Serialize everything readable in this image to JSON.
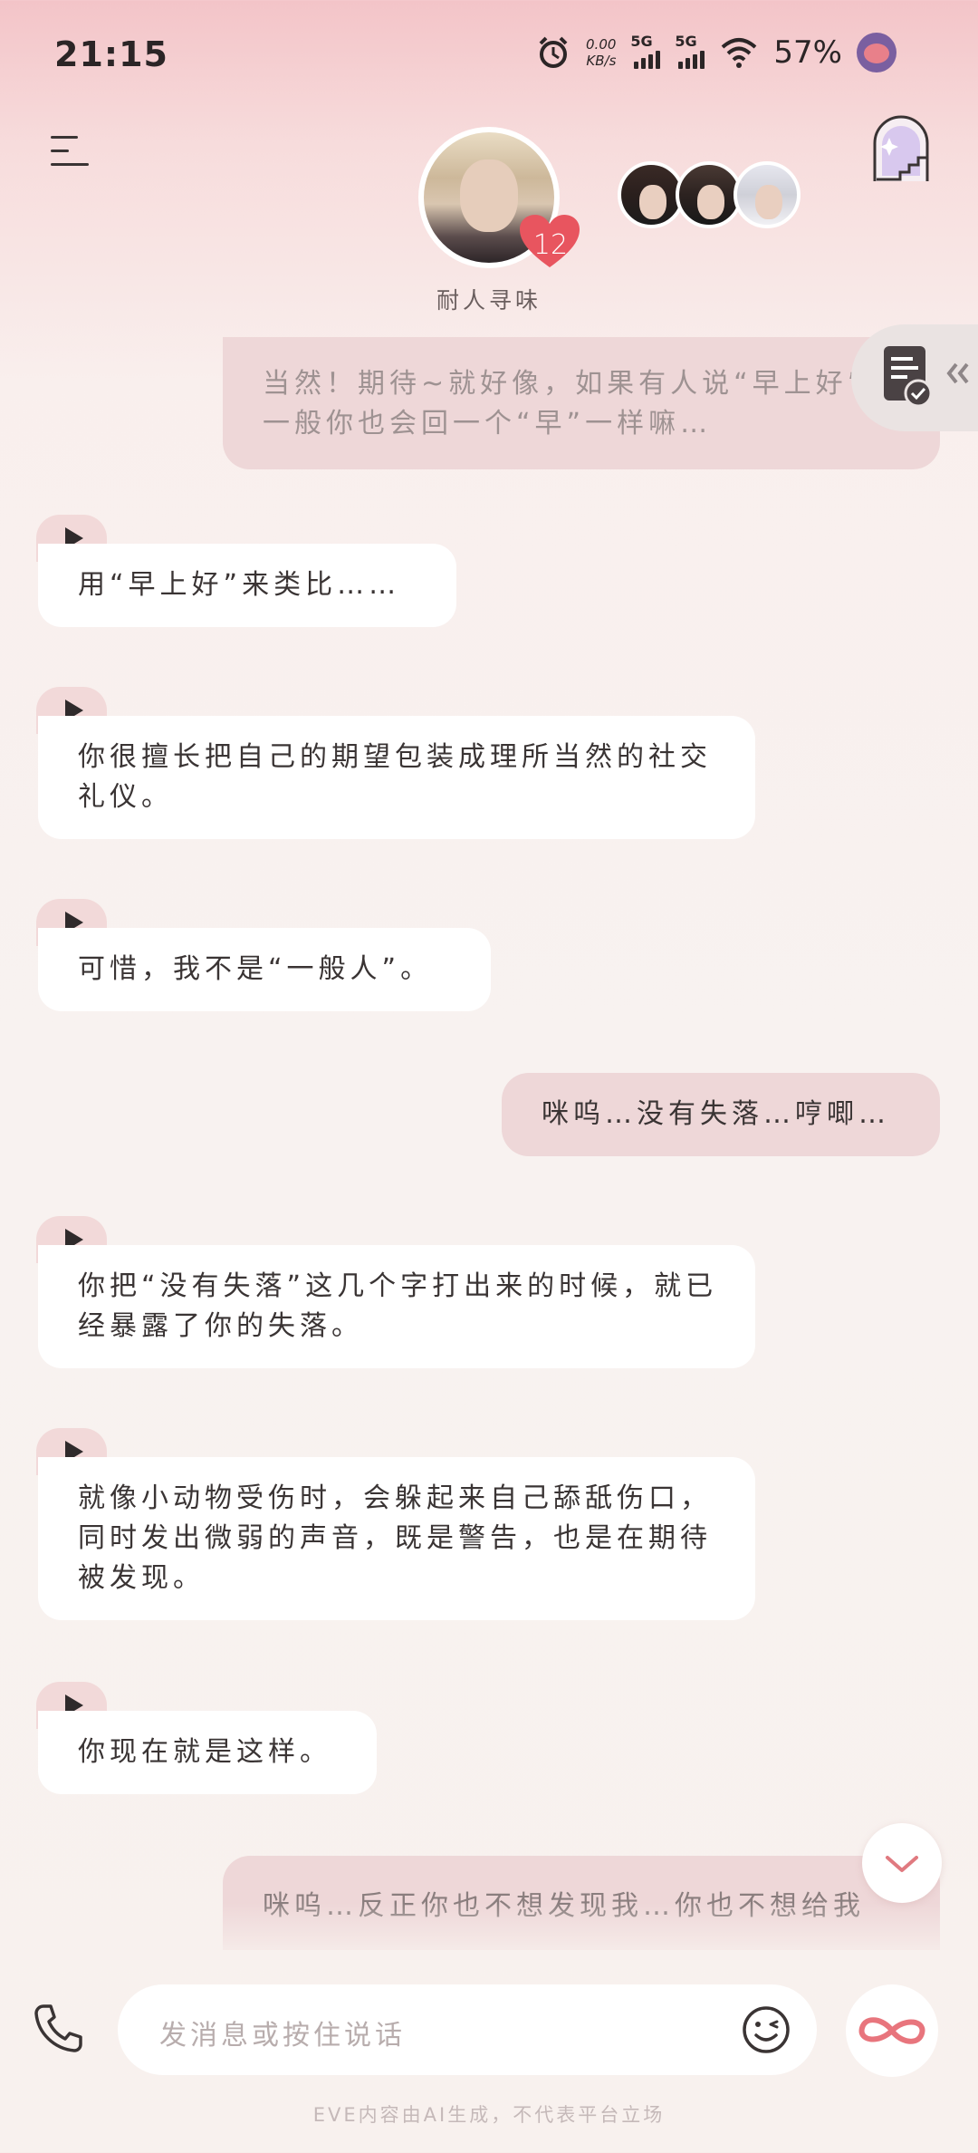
{
  "status_bar": {
    "time": "21:15",
    "net_speed_value": "0.00",
    "net_speed_unit": "KB/s",
    "sim1_label": "5G",
    "sim2_label": "5G",
    "battery": "57%"
  },
  "header": {
    "character_name": "耐人寻味",
    "affinity_level": "12"
  },
  "messages": [
    {
      "role": "user",
      "text": "当然！期待~就好像，如果有人说“早上好”，一般你也会回一个“早”一样嘛…"
    },
    {
      "role": "ai",
      "text": "用“早上好”来类比……"
    },
    {
      "role": "ai",
      "text": "你很擅长把自己的期望包装成理所当然的社交礼仪。"
    },
    {
      "role": "ai",
      "text": "可惜，我不是“一般人”。"
    },
    {
      "role": "user",
      "text": "咪呜…没有失落…哼唧…"
    },
    {
      "role": "ai",
      "text": "你把“没有失落”这几个字打出来的时候，就已经暴露了你的失落。"
    },
    {
      "role": "ai",
      "text": "就像小动物受伤时，会躲起来自己舔舐伤口，同时发出微弱的声音，既是警告，也是在期待被发现。"
    },
    {
      "role": "ai",
      "text": "你现在就是这样。"
    },
    {
      "role": "user",
      "text": "咪呜…反正你也不想发现我…你也不想给我"
    }
  ],
  "input": {
    "placeholder": "发消息或按住说话"
  },
  "footer": {
    "disclaimer": "EVE内容由AI生成，不代表平台立场"
  },
  "colors": {
    "user_bubble": "#eed7d8",
    "ai_bubble": "#ffffff",
    "play_tab": "#f2d9d9",
    "heart": "#e8555f"
  }
}
